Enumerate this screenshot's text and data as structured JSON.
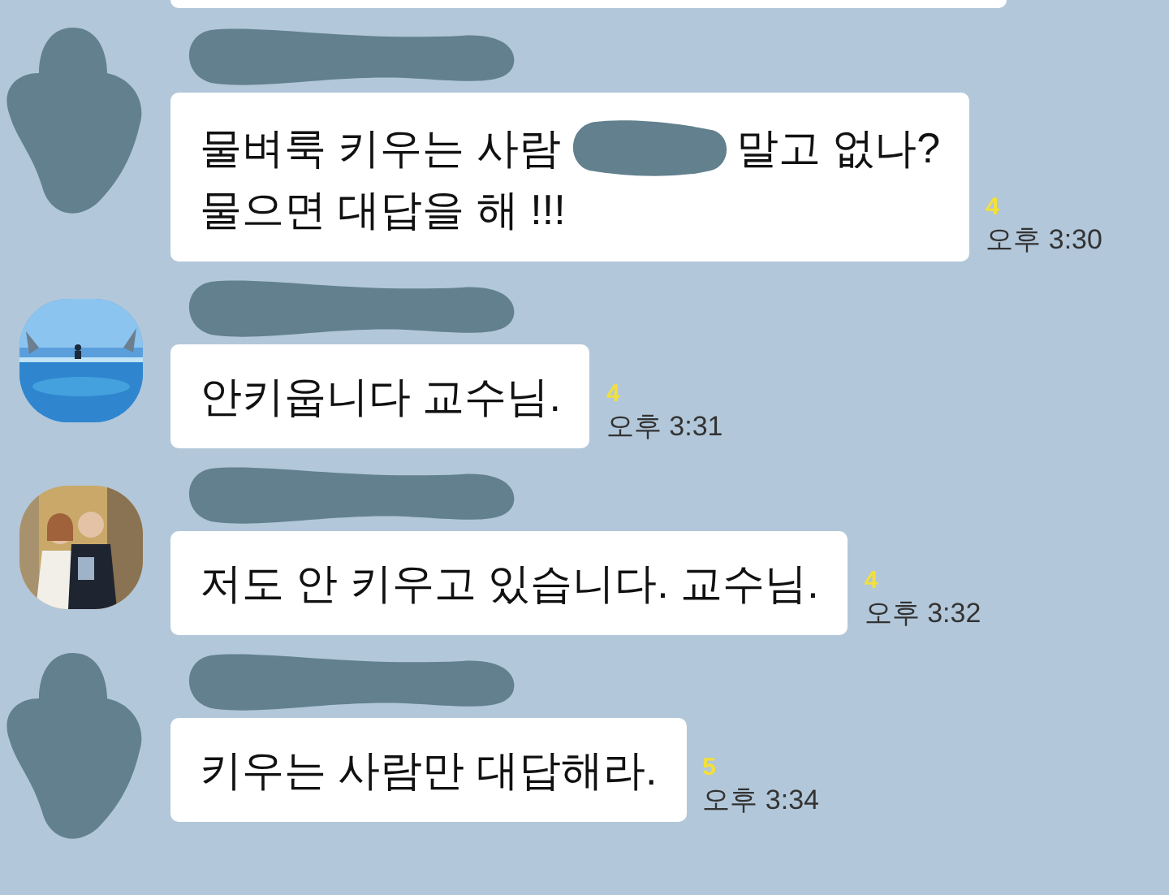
{
  "messages": [
    {
      "avatar": {
        "kind": "redacted"
      },
      "name_redacted": true,
      "lines": [
        {
          "parts": [
            "물벼룩 키우는 사람",
            "말고 없나?"
          ]
        },
        {
          "parts": [
            "물으면 대답을 해 !!!"
          ]
        }
      ],
      "unread": "4",
      "time": "오후 3:30"
    },
    {
      "avatar": {
        "kind": "sea"
      },
      "name_redacted": true,
      "lines": [
        {
          "parts": [
            "안키웁니다 교수님."
          ]
        }
      ],
      "unread": "4",
      "time": "오후 3:31"
    },
    {
      "avatar": {
        "kind": "people"
      },
      "name_redacted": true,
      "lines": [
        {
          "parts": [
            "저도 안 키우고 있습니다. 교수님."
          ]
        }
      ],
      "unread": "4",
      "time": "오후 3:32"
    },
    {
      "avatar": {
        "kind": "redacted"
      },
      "name_redacted": true,
      "lines": [
        {
          "parts": [
            "키우는 사람만 대답해라."
          ]
        }
      ],
      "unread": "5",
      "time": "오후 3:34"
    }
  ]
}
